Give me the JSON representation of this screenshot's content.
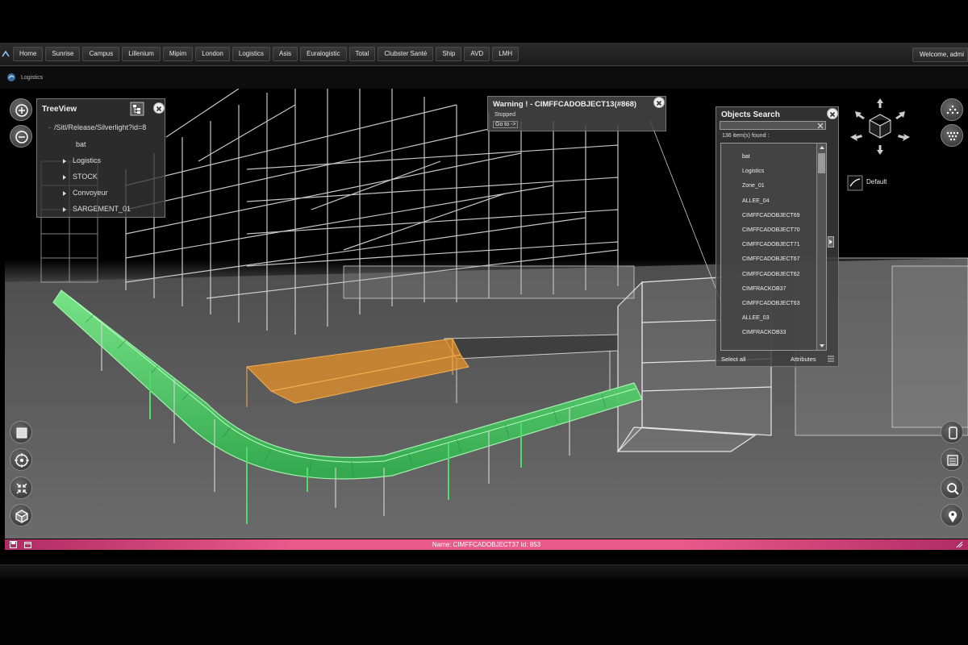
{
  "nav": {
    "items": [
      "Home",
      "Sunrise",
      "Campus",
      "Lillenium",
      "Mipim",
      "London",
      "Logistics",
      "Asis",
      "Euralogistic",
      "Total",
      "Clubster Santé",
      "Ship",
      "AVD",
      "LMH"
    ],
    "welcome": "Welcome, admi"
  },
  "breadcrumb": {
    "label": "Logistics"
  },
  "treeview": {
    "title": "TreeView",
    "root": "/Sitl/Release/Silverlight?id=8",
    "items": [
      "bat",
      "Logistics",
      "STOCK",
      "Convoyeur",
      "SARGEMENT_01"
    ]
  },
  "warning": {
    "title": "Warning ! - CIMFFCADOBJECT13(#868)",
    "status": "Stopped",
    "goto": "Go to ->"
  },
  "search": {
    "title": "Objects Search",
    "input_value": "",
    "count": "136 item(s) found :",
    "items": [
      "bat",
      "Logistics",
      "Zone_01",
      "ALLEE_04",
      "CIMFFCADOBJECT69",
      "CIMFFCADOBJECT70",
      "CIMFFCADOBJECT71",
      "CIMFFCADOBJECT67",
      "CIMFFCADOBJECT62",
      "CIMFRACKOB37",
      "CIMFFCADOBJECT63",
      "ALLEE_03",
      "CIMFRACKOB33"
    ],
    "select_all": "Select all",
    "attributes": "Attributes"
  },
  "view": {
    "default_label": "Default"
  },
  "status_bar": {
    "text": "Name: CIMFFCADOBJECT37 Id: 853"
  },
  "colors": {
    "conveyor": "#3fd35f",
    "orange": "#e8902a",
    "status": "#e85a8a"
  }
}
